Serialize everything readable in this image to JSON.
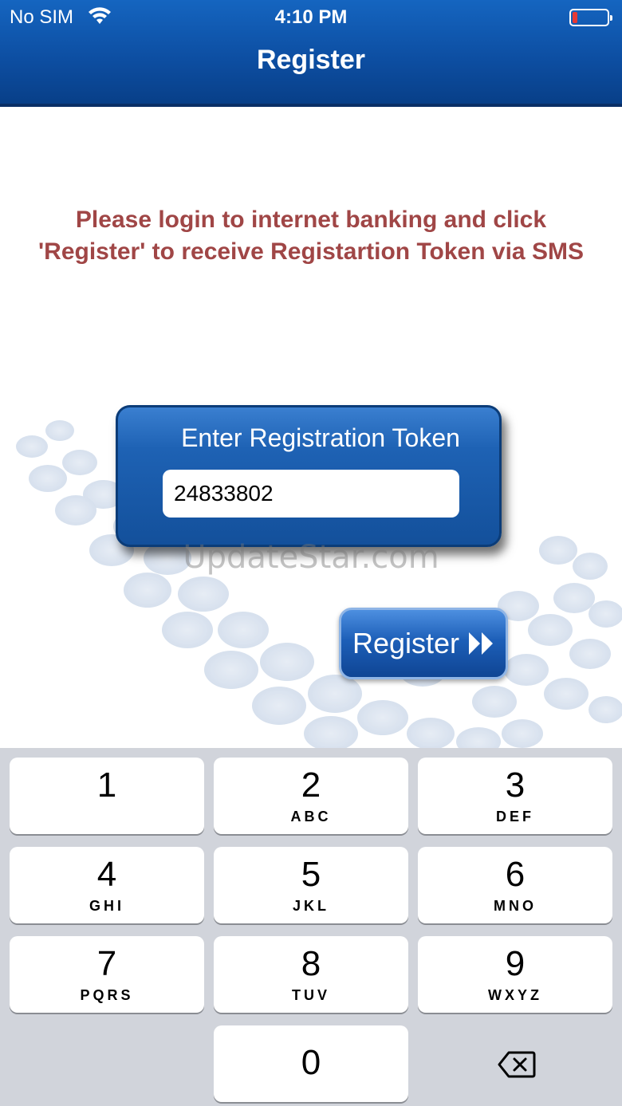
{
  "status_bar": {
    "carrier": "No SIM",
    "time": "4:10 PM",
    "wifi_icon": "wifi-icon",
    "battery_icon": "battery-low-icon",
    "battery_level_color": "#e53935"
  },
  "nav": {
    "title": "Register"
  },
  "instructions": "Please login to internet banking and click 'Register' to receive Registartion Token via SMS",
  "token": {
    "label": "Enter Registration Token",
    "value": "24833802"
  },
  "watermark": "UpdateStar.com",
  "register_button": {
    "label": "Register",
    "icon": "double-chevron-right-icon"
  },
  "keypad": {
    "keys": [
      {
        "digit": "1",
        "letters": ""
      },
      {
        "digit": "2",
        "letters": "ABC"
      },
      {
        "digit": "3",
        "letters": "DEF"
      },
      {
        "digit": "4",
        "letters": "GHI"
      },
      {
        "digit": "5",
        "letters": "JKL"
      },
      {
        "digit": "6",
        "letters": "MNO"
      },
      {
        "digit": "7",
        "letters": "PQRS"
      },
      {
        "digit": "8",
        "letters": "TUV"
      },
      {
        "digit": "9",
        "letters": "WXYZ"
      },
      {
        "digit": "0",
        "letters": ""
      }
    ],
    "delete_icon": "backspace-icon"
  },
  "colors": {
    "nav_blue": "#0d4fa3",
    "instruction_text": "#a04646",
    "keypad_bg": "#d1d4db"
  }
}
